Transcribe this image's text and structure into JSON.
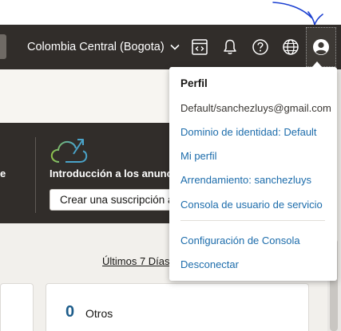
{
  "topbar": {
    "region": "Colombia Central (Bogota)",
    "icons": [
      "code-editor-icon",
      "bell-icon",
      "help-icon",
      "globe-icon",
      "user-icon"
    ]
  },
  "hero": {
    "partial_text": "e",
    "card_title": "Introducción a los anuncios",
    "card_button": "Crear una suscripción a"
  },
  "filter": {
    "period": "Últimos 7 Días"
  },
  "summary_card": {
    "count": "0",
    "label": "Otros"
  },
  "profile_menu": {
    "title": "Perfil",
    "email": "Default/sanchezluys@gmail.com",
    "items": [
      "Dominio de identidad: Default",
      "Mi perfil",
      "Arrendamiento: sanchezluys",
      "Consola de usuario de servicio"
    ],
    "footer_items": [
      "Configuración de Consola",
      "Desconectar"
    ]
  },
  "colors": {
    "topbar_bg": "#312d2a",
    "link": "#1c6cab",
    "count": "#1c5c8a",
    "annotation": "#1a3fd1"
  }
}
